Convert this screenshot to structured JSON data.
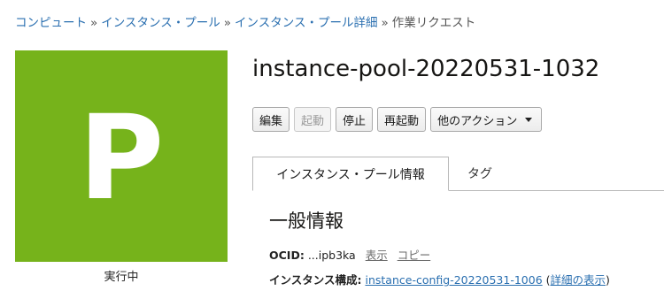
{
  "breadcrumb": {
    "items": [
      "コンピュート",
      "インスタンス・プール",
      "インスタンス・プール詳細"
    ],
    "current": "作業リクエスト",
    "separator": "»"
  },
  "status_tile": {
    "letter": "P",
    "status": "実行中",
    "color": "#76b31b"
  },
  "title": "instance-pool-20220531-1032",
  "actions": {
    "edit": "編集",
    "start": "起動",
    "stop": "停止",
    "reboot": "再起動",
    "more": "他のアクション"
  },
  "tabs": {
    "info": "インスタンス・プール情報",
    "tags": "タグ"
  },
  "general": {
    "title": "一般情報",
    "ocid_label": "OCID:",
    "ocid_value": "...ipb3ka",
    "show": "表示",
    "copy": "コピー",
    "config_label": "インスタンス構成:",
    "config_value": "instance-config-20220531-1006",
    "details_open": "(",
    "details_link": "詳細の表示",
    "details_close": ")"
  }
}
